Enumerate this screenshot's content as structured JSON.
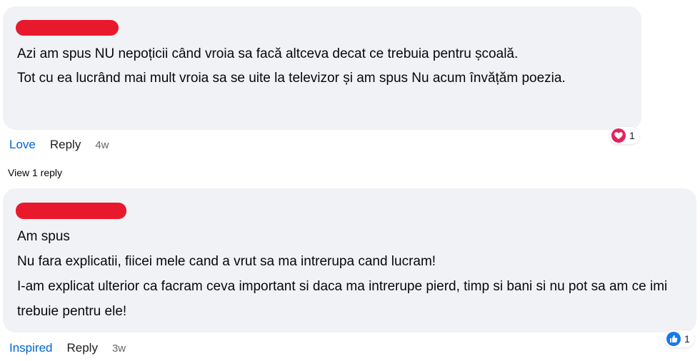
{
  "comments": [
    {
      "lines": [
        "Azi am spus NU nepoțicii când vroia sa facă altceva decat ce trebuia pentru școală.",
        "Tot cu ea lucrând mai mult vroia sa se uite la televizor și am spus Nu acum învățăm poezia."
      ],
      "reaction_label": "Love",
      "reply_label": "Reply",
      "time": "4w",
      "reaction_icon": "heart-reaction-icon",
      "reaction_color": "#e0245e",
      "reaction_count": "1",
      "view_replies": "View 1 reply"
    },
    {
      "lines": [
        "Am spus",
        "Nu fara explicatii, fiicei mele cand a vrut sa ma intrerupa cand lucram!",
        "I-am explicat ulterior ca facram ceva important si daca ma intrerupe pierd, timp si bani si nu pot sa am ce imi trebuie pentru ele!"
      ],
      "reaction_label": "Inspired",
      "reply_label": "Reply",
      "time": "3w",
      "reaction_icon": "like-reaction-icon",
      "reaction_color": "#1877f2",
      "reaction_count": "1"
    }
  ],
  "colors": {
    "bubble": "#f0f2f5",
    "redaction": "#e8192c",
    "reacted_text": "#0064d1"
  }
}
